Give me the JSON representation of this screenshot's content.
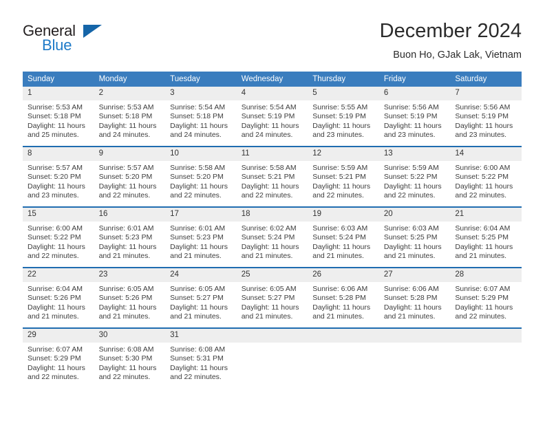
{
  "brand": {
    "name_top": "General",
    "name_bottom": "Blue",
    "accent_color": "#1e7ac8",
    "triangle_color": "#1565a8"
  },
  "header": {
    "title": "December 2024",
    "subtitle": "Buon Ho, GJak Lak, Vietnam"
  },
  "theme": {
    "header_blue": "#3a7dbe",
    "row_divider_blue": "#1f6cb0",
    "daynum_bg": "#eeeeee",
    "text": "#3c3c3c"
  },
  "calendar": {
    "weekday_headers": [
      "Sunday",
      "Monday",
      "Tuesday",
      "Wednesday",
      "Thursday",
      "Friday",
      "Saturday"
    ],
    "weeks": [
      [
        {
          "day": "1",
          "sunrise": "Sunrise: 5:53 AM",
          "sunset": "Sunset: 5:18 PM",
          "daylight1": "Daylight: 11 hours",
          "daylight2": "and 25 minutes."
        },
        {
          "day": "2",
          "sunrise": "Sunrise: 5:53 AM",
          "sunset": "Sunset: 5:18 PM",
          "daylight1": "Daylight: 11 hours",
          "daylight2": "and 24 minutes."
        },
        {
          "day": "3",
          "sunrise": "Sunrise: 5:54 AM",
          "sunset": "Sunset: 5:18 PM",
          "daylight1": "Daylight: 11 hours",
          "daylight2": "and 24 minutes."
        },
        {
          "day": "4",
          "sunrise": "Sunrise: 5:54 AM",
          "sunset": "Sunset: 5:19 PM",
          "daylight1": "Daylight: 11 hours",
          "daylight2": "and 24 minutes."
        },
        {
          "day": "5",
          "sunrise": "Sunrise: 5:55 AM",
          "sunset": "Sunset: 5:19 PM",
          "daylight1": "Daylight: 11 hours",
          "daylight2": "and 23 minutes."
        },
        {
          "day": "6",
          "sunrise": "Sunrise: 5:56 AM",
          "sunset": "Sunset: 5:19 PM",
          "daylight1": "Daylight: 11 hours",
          "daylight2": "and 23 minutes."
        },
        {
          "day": "7",
          "sunrise": "Sunrise: 5:56 AM",
          "sunset": "Sunset: 5:19 PM",
          "daylight1": "Daylight: 11 hours",
          "daylight2": "and 23 minutes."
        }
      ],
      [
        {
          "day": "8",
          "sunrise": "Sunrise: 5:57 AM",
          "sunset": "Sunset: 5:20 PM",
          "daylight1": "Daylight: 11 hours",
          "daylight2": "and 23 minutes."
        },
        {
          "day": "9",
          "sunrise": "Sunrise: 5:57 AM",
          "sunset": "Sunset: 5:20 PM",
          "daylight1": "Daylight: 11 hours",
          "daylight2": "and 22 minutes."
        },
        {
          "day": "10",
          "sunrise": "Sunrise: 5:58 AM",
          "sunset": "Sunset: 5:20 PM",
          "daylight1": "Daylight: 11 hours",
          "daylight2": "and 22 minutes."
        },
        {
          "day": "11",
          "sunrise": "Sunrise: 5:58 AM",
          "sunset": "Sunset: 5:21 PM",
          "daylight1": "Daylight: 11 hours",
          "daylight2": "and 22 minutes."
        },
        {
          "day": "12",
          "sunrise": "Sunrise: 5:59 AM",
          "sunset": "Sunset: 5:21 PM",
          "daylight1": "Daylight: 11 hours",
          "daylight2": "and 22 minutes."
        },
        {
          "day": "13",
          "sunrise": "Sunrise: 5:59 AM",
          "sunset": "Sunset: 5:22 PM",
          "daylight1": "Daylight: 11 hours",
          "daylight2": "and 22 minutes."
        },
        {
          "day": "14",
          "sunrise": "Sunrise: 6:00 AM",
          "sunset": "Sunset: 5:22 PM",
          "daylight1": "Daylight: 11 hours",
          "daylight2": "and 22 minutes."
        }
      ],
      [
        {
          "day": "15",
          "sunrise": "Sunrise: 6:00 AM",
          "sunset": "Sunset: 5:22 PM",
          "daylight1": "Daylight: 11 hours",
          "daylight2": "and 22 minutes."
        },
        {
          "day": "16",
          "sunrise": "Sunrise: 6:01 AM",
          "sunset": "Sunset: 5:23 PM",
          "daylight1": "Daylight: 11 hours",
          "daylight2": "and 21 minutes."
        },
        {
          "day": "17",
          "sunrise": "Sunrise: 6:01 AM",
          "sunset": "Sunset: 5:23 PM",
          "daylight1": "Daylight: 11 hours",
          "daylight2": "and 21 minutes."
        },
        {
          "day": "18",
          "sunrise": "Sunrise: 6:02 AM",
          "sunset": "Sunset: 5:24 PM",
          "daylight1": "Daylight: 11 hours",
          "daylight2": "and 21 minutes."
        },
        {
          "day": "19",
          "sunrise": "Sunrise: 6:03 AM",
          "sunset": "Sunset: 5:24 PM",
          "daylight1": "Daylight: 11 hours",
          "daylight2": "and 21 minutes."
        },
        {
          "day": "20",
          "sunrise": "Sunrise: 6:03 AM",
          "sunset": "Sunset: 5:25 PM",
          "daylight1": "Daylight: 11 hours",
          "daylight2": "and 21 minutes."
        },
        {
          "day": "21",
          "sunrise": "Sunrise: 6:04 AM",
          "sunset": "Sunset: 5:25 PM",
          "daylight1": "Daylight: 11 hours",
          "daylight2": "and 21 minutes."
        }
      ],
      [
        {
          "day": "22",
          "sunrise": "Sunrise: 6:04 AM",
          "sunset": "Sunset: 5:26 PM",
          "daylight1": "Daylight: 11 hours",
          "daylight2": "and 21 minutes."
        },
        {
          "day": "23",
          "sunrise": "Sunrise: 6:05 AM",
          "sunset": "Sunset: 5:26 PM",
          "daylight1": "Daylight: 11 hours",
          "daylight2": "and 21 minutes."
        },
        {
          "day": "24",
          "sunrise": "Sunrise: 6:05 AM",
          "sunset": "Sunset: 5:27 PM",
          "daylight1": "Daylight: 11 hours",
          "daylight2": "and 21 minutes."
        },
        {
          "day": "25",
          "sunrise": "Sunrise: 6:05 AM",
          "sunset": "Sunset: 5:27 PM",
          "daylight1": "Daylight: 11 hours",
          "daylight2": "and 21 minutes."
        },
        {
          "day": "26",
          "sunrise": "Sunrise: 6:06 AM",
          "sunset": "Sunset: 5:28 PM",
          "daylight1": "Daylight: 11 hours",
          "daylight2": "and 21 minutes."
        },
        {
          "day": "27",
          "sunrise": "Sunrise: 6:06 AM",
          "sunset": "Sunset: 5:28 PM",
          "daylight1": "Daylight: 11 hours",
          "daylight2": "and 21 minutes."
        },
        {
          "day": "28",
          "sunrise": "Sunrise: 6:07 AM",
          "sunset": "Sunset: 5:29 PM",
          "daylight1": "Daylight: 11 hours",
          "daylight2": "and 22 minutes."
        }
      ],
      [
        {
          "day": "29",
          "sunrise": "Sunrise: 6:07 AM",
          "sunset": "Sunset: 5:29 PM",
          "daylight1": "Daylight: 11 hours",
          "daylight2": "and 22 minutes."
        },
        {
          "day": "30",
          "sunrise": "Sunrise: 6:08 AM",
          "sunset": "Sunset: 5:30 PM",
          "daylight1": "Daylight: 11 hours",
          "daylight2": "and 22 minutes."
        },
        {
          "day": "31",
          "sunrise": "Sunrise: 6:08 AM",
          "sunset": "Sunset: 5:31 PM",
          "daylight1": "Daylight: 11 hours",
          "daylight2": "and 22 minutes."
        },
        {
          "day": "",
          "sunrise": "",
          "sunset": "",
          "daylight1": "",
          "daylight2": ""
        },
        {
          "day": "",
          "sunrise": "",
          "sunset": "",
          "daylight1": "",
          "daylight2": ""
        },
        {
          "day": "",
          "sunrise": "",
          "sunset": "",
          "daylight1": "",
          "daylight2": ""
        },
        {
          "day": "",
          "sunrise": "",
          "sunset": "",
          "daylight1": "",
          "daylight2": ""
        }
      ]
    ]
  }
}
